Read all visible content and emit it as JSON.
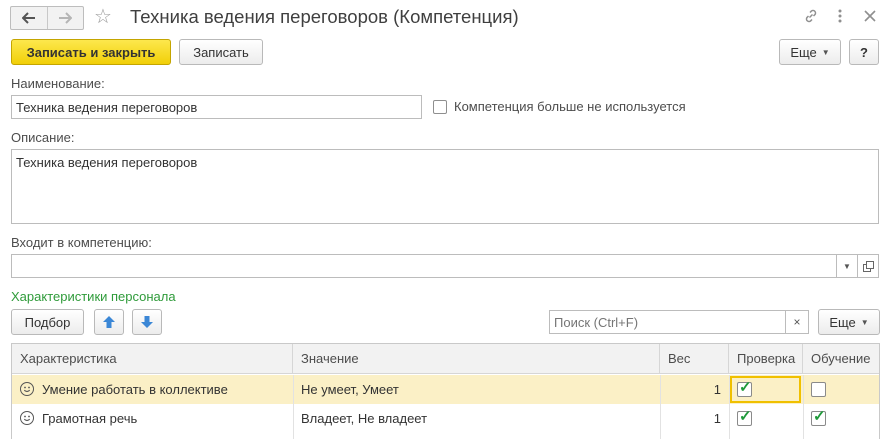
{
  "window": {
    "title": "Техника ведения переговоров (Компетенция)"
  },
  "toolbar": {
    "save_close": "Записать и закрыть",
    "save": "Записать",
    "more": "Еще",
    "help": "?"
  },
  "form": {
    "name_label": "Наименование:",
    "name_value": "Техника ведения переговоров",
    "unused_label": "Компетенция больше не используется",
    "description_label": "Описание:",
    "description_value": "Техника ведения переговоров",
    "parent_label": "Входит в компетенцию:",
    "parent_value": ""
  },
  "characteristics": {
    "group_title": "Характеристики персонала",
    "pick_button": "Подбор",
    "search_placeholder": "Поиск (Ctrl+F)",
    "more": "Еще",
    "columns": [
      "Характеристика",
      "Значение",
      "Вес",
      "Проверка",
      "Обучение"
    ],
    "rows": [
      {
        "name": "Умение работать в коллективе",
        "value": "Не умеет, Умеет",
        "weight": "1",
        "check": true,
        "training": false
      },
      {
        "name": "Грамотная речь",
        "value": "Владеет, Не владеет",
        "weight": "1",
        "check": true,
        "training": true
      }
    ]
  },
  "icons": {
    "back": "arrow-left-icon",
    "forward": "arrow-right-icon",
    "favorite": "star-icon",
    "link": "link-icon",
    "menu": "more-vertical-icon",
    "close": "close-icon",
    "row": "smiley-icon"
  },
  "colors": {
    "primary_button": "#f5d90a",
    "group_title": "#2f9b3a",
    "selected_row": "#fbf0c6",
    "checkmark": "#1f9a3a",
    "arrow_button": "#3b87d6"
  }
}
